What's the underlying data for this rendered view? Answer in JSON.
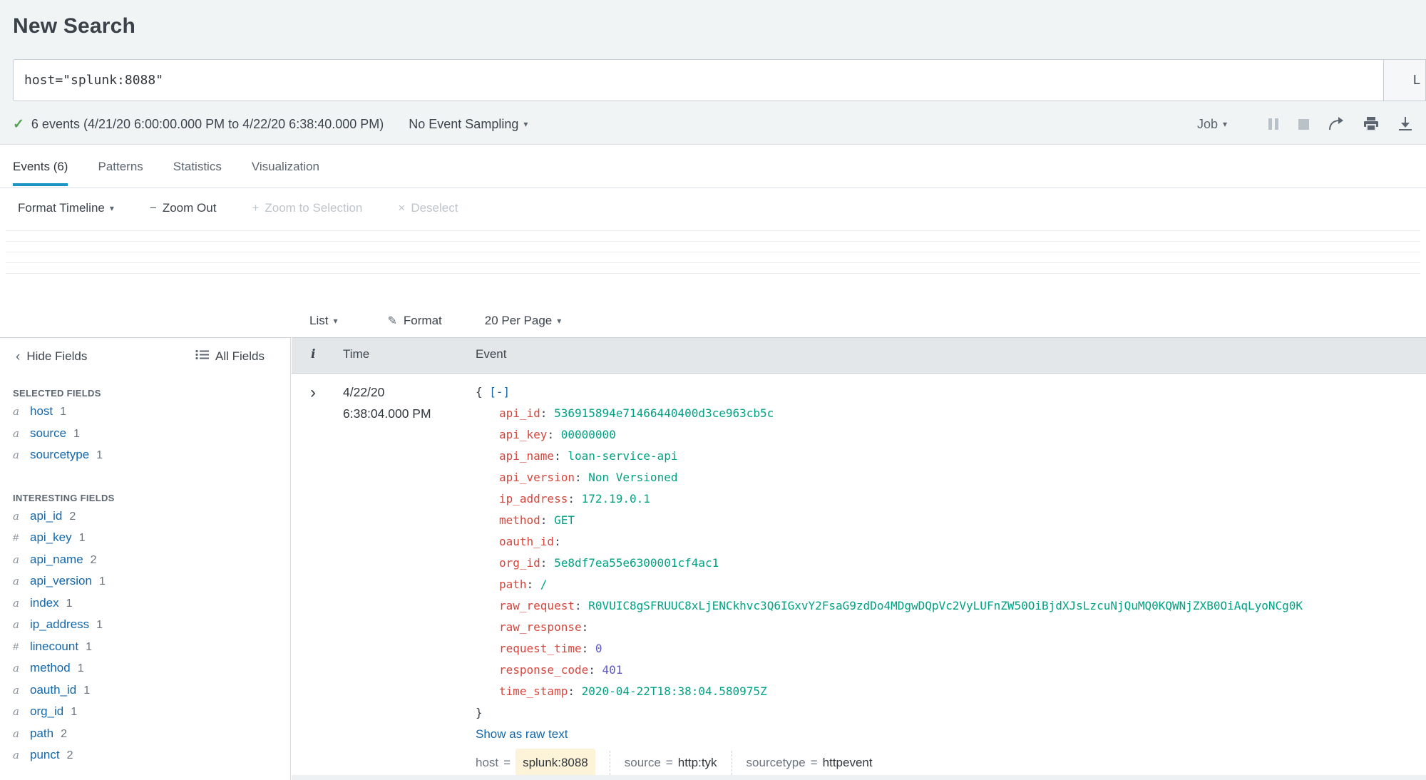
{
  "page": {
    "title": "New Search"
  },
  "search": {
    "query": "host=\"splunk:8088\"",
    "time_range_visible": "L"
  },
  "status": {
    "event_count_text": "6 events (4/21/20 6:00:00.000 PM to 4/22/20 6:38:40.000 PM)",
    "sampling_label": "No Event Sampling",
    "job_label": "Job"
  },
  "tabs": [
    {
      "label": "Events (6)",
      "active": "active"
    },
    {
      "label": "Patterns",
      "active": ""
    },
    {
      "label": "Statistics",
      "active": ""
    },
    {
      "label": "Visualization",
      "active": ""
    }
  ],
  "timeline_toolbar": {
    "format_timeline": "Format Timeline",
    "zoom_out": "Zoom Out",
    "zoom_to_selection": "Zoom to Selection",
    "deselect": "Deselect"
  },
  "results_toolbar": {
    "list": "List",
    "format": "Format",
    "per_page": "20 Per Page"
  },
  "fields_panel": {
    "hide_fields": "Hide Fields",
    "all_fields": "All Fields",
    "selected_header": "SELECTED FIELDS",
    "interesting_header": "INTERESTING FIELDS",
    "selected": [
      {
        "prefix": "a",
        "ptype": "alpha",
        "name": "host",
        "count": "1"
      },
      {
        "prefix": "a",
        "ptype": "alpha",
        "name": "source",
        "count": "1"
      },
      {
        "prefix": "a",
        "ptype": "alpha",
        "name": "sourcetype",
        "count": "1"
      }
    ],
    "interesting": [
      {
        "prefix": "a",
        "ptype": "alpha",
        "name": "api_id",
        "count": "2"
      },
      {
        "prefix": "#",
        "ptype": "num",
        "name": "api_key",
        "count": "1"
      },
      {
        "prefix": "a",
        "ptype": "alpha",
        "name": "api_name",
        "count": "2"
      },
      {
        "prefix": "a",
        "ptype": "alpha",
        "name": "api_version",
        "count": "1"
      },
      {
        "prefix": "a",
        "ptype": "alpha",
        "name": "index",
        "count": "1"
      },
      {
        "prefix": "a",
        "ptype": "alpha",
        "name": "ip_address",
        "count": "1"
      },
      {
        "prefix": "#",
        "ptype": "num",
        "name": "linecount",
        "count": "1"
      },
      {
        "prefix": "a",
        "ptype": "alpha",
        "name": "method",
        "count": "1"
      },
      {
        "prefix": "a",
        "ptype": "alpha",
        "name": "oauth_id",
        "count": "1"
      },
      {
        "prefix": "a",
        "ptype": "alpha",
        "name": "org_id",
        "count": "1"
      },
      {
        "prefix": "a",
        "ptype": "alpha",
        "name": "path",
        "count": "2"
      },
      {
        "prefix": "a",
        "ptype": "alpha",
        "name": "punct",
        "count": "2"
      }
    ]
  },
  "events_table": {
    "info_header": "i",
    "time_header": "Time",
    "event_header": "Event",
    "event": {
      "date": "4/22/20",
      "time": "6:38:04.000 PM",
      "open_brace": "{ ",
      "collapse_control": "[-]",
      "close_brace": "}",
      "colon_sep": ": ",
      "meta_eq": "=",
      "fields": [
        {
          "key": "api_id",
          "value": "536915894e71466440400d3ce963cb5c",
          "type": "string"
        },
        {
          "key": "api_key",
          "value": "00000000",
          "type": "string"
        },
        {
          "key": "api_name",
          "value": "loan-service-api",
          "type": "string"
        },
        {
          "key": "api_version",
          "value": "Non Versioned",
          "type": "string"
        },
        {
          "key": "ip_address",
          "value": "172.19.0.1",
          "type": "string"
        },
        {
          "key": "method",
          "value": "GET",
          "type": "string"
        },
        {
          "key": "oauth_id",
          "value": "",
          "type": "empty"
        },
        {
          "key": "org_id",
          "value": "5e8df7ea55e6300001cf4ac1",
          "type": "string"
        },
        {
          "key": "path",
          "value": "/",
          "type": "string"
        },
        {
          "key": "raw_request",
          "value": "R0VUIC8gSFRUUC8xLjENCkhvc3Q6IGxvY2FsaG9zdDo4MDgwDQpVc2VyLUFnZW50OiBjdXJsLzcuNjQuMQ0KQWNjZXB0OiAqLyoNCg0K",
          "type": "string"
        },
        {
          "key": "raw_response",
          "value": "",
          "type": "empty"
        },
        {
          "key": "request_time",
          "value": "0",
          "type": "number"
        },
        {
          "key": "response_code",
          "value": "401",
          "type": "number"
        },
        {
          "key": "time_stamp",
          "value": "2020-04-22T18:38:04.580975Z",
          "type": "string"
        }
      ],
      "show_raw_label": "Show as raw text",
      "meta": [
        {
          "key": "host",
          "value": "splunk:8088",
          "hl": "highlight"
        },
        {
          "key": "source",
          "value": "http:tyk",
          "hl": ""
        },
        {
          "key": "sourcetype",
          "value": "httpevent",
          "hl": ""
        }
      ]
    }
  },
  "icons": {
    "caret_down": "▾",
    "check": "✓",
    "chevron_left": "‹",
    "chevron_right": "›",
    "minus": "−",
    "plus": "+",
    "x": "×",
    "pencil": "✎"
  },
  "colors": {
    "accent_blue": "#1e93c6",
    "link_blue": "#1267ab",
    "json_key_red": "#d6463c",
    "json_string_teal": "#00a284",
    "json_number_purple": "#5b58c4",
    "highlight_yellow": "#fcf3d8",
    "check_green": "#53a051",
    "header_band_gray": "#e3e7ea",
    "top_section_gray": "#f1f4f5"
  }
}
